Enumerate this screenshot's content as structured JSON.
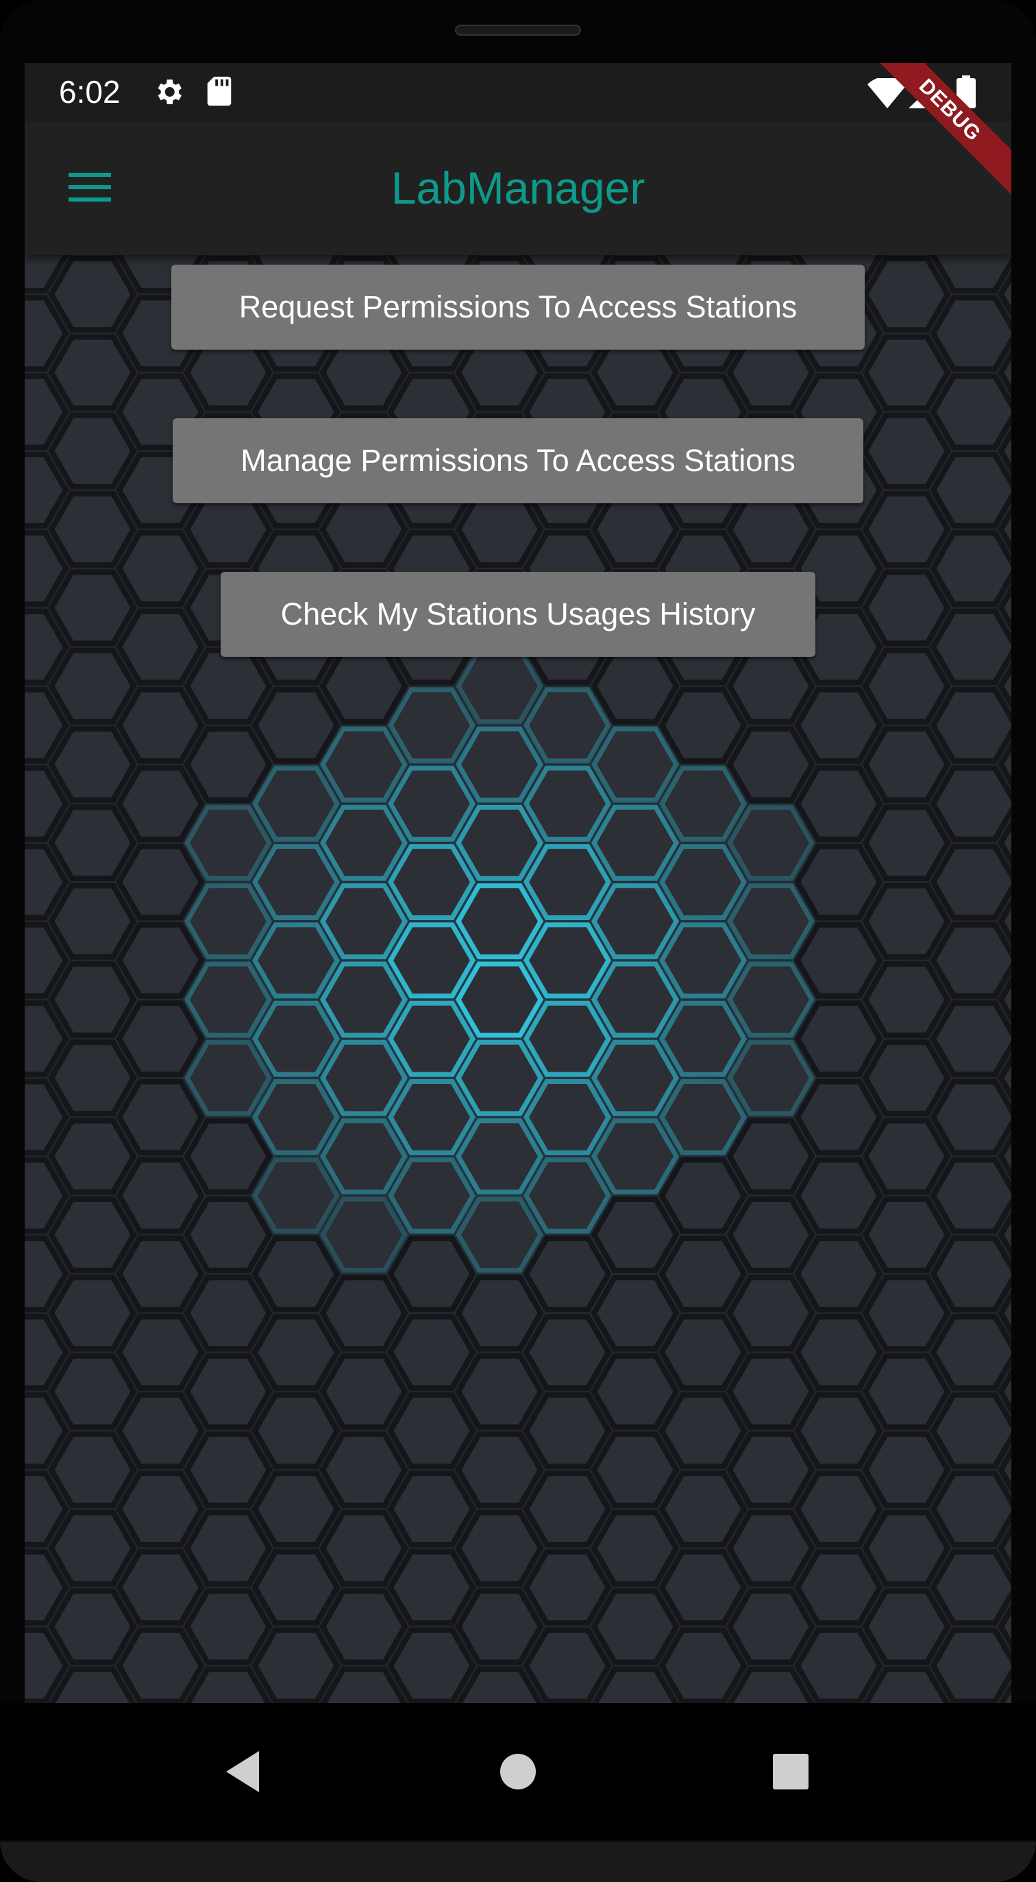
{
  "status_bar": {
    "time": "6:02",
    "left_icons": [
      "gear-icon",
      "sd-card-icon"
    ],
    "right_icons": [
      "wifi-icon",
      "cell-signal-icon",
      "battery-icon"
    ]
  },
  "debug_banner": "DEBUG",
  "app_bar": {
    "title": "LabManager",
    "menu_icon": "hamburger-menu-icon",
    "title_color": "#0e9a8a"
  },
  "buttons": {
    "request_permissions": "Request Permissions To Access Stations",
    "manage_permissions": "Manage Permissions To Access Stations",
    "usage_history": "Check My Stations Usages History"
  },
  "nav_bar": {
    "icons": [
      "back-icon",
      "home-icon",
      "recents-icon"
    ]
  },
  "colors": {
    "accent": "#0e9a8a",
    "button_bg": "#757575",
    "hex_glow": "#33d6f0",
    "debug_banner": "#8f1a1f"
  }
}
